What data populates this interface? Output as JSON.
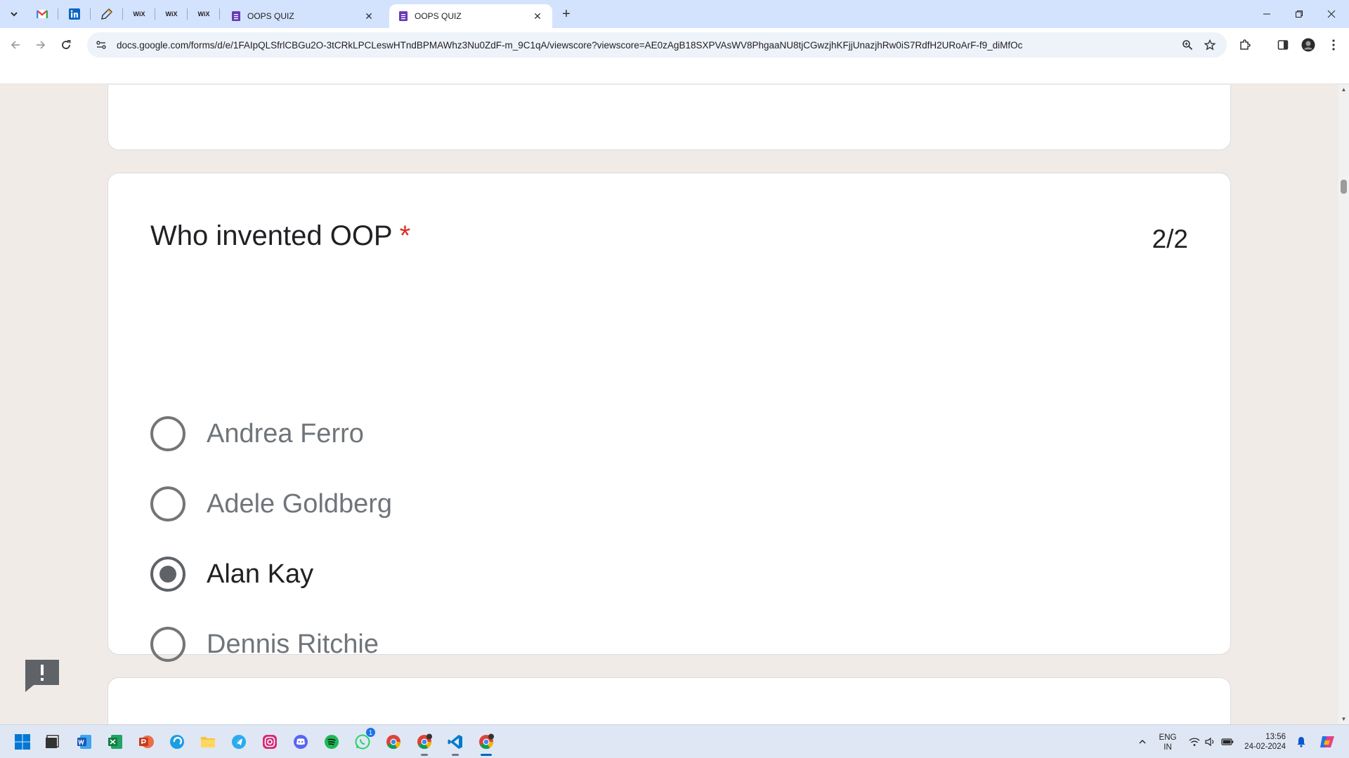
{
  "browser": {
    "tabs": [
      {
        "title": "OOPS QUIZ",
        "active": false
      },
      {
        "title": "OOPS QUIZ",
        "active": true
      }
    ],
    "pinned_tabs": [
      "gmail-icon",
      "linkedin-icon",
      "pen-icon",
      "wix-icon",
      "wix-icon",
      "wix-icon"
    ],
    "pinned_wix_label": "WiX",
    "url": "docs.google.com/forms/d/e/1FAIpQLSfrlCBGu2O-3tCRkLPCLeswHTndBPMAWhz3Nu0ZdF-m_9C1qA/viewscore?viewscore=AE0zAgB18SXPVAsWV8PhgaaNU8tjCGwzjhKFjjUnazjhRw0iS7RdfH2URoArF-f9_diMfOc"
  },
  "question": {
    "title": "Who invented OOP",
    "required_mark": "*",
    "score": "2/2",
    "options": [
      {
        "label": "Andrea Ferro",
        "selected": false
      },
      {
        "label": "Adele Goldberg",
        "selected": false
      },
      {
        "label": "Alan Kay",
        "selected": true
      },
      {
        "label": "Dennis Ritchie",
        "selected": false
      }
    ]
  },
  "taskbar": {
    "apps": [
      "windows-start-icon",
      "file-manager-icon",
      "word-icon",
      "excel-icon",
      "powerpoint-icon",
      "edge-icon",
      "file-explorer-icon",
      "telegram-icon",
      "instagram-icon",
      "discord-icon",
      "spotify-icon",
      "whatsapp-icon",
      "chrome-icon",
      "chrome-profile-icon",
      "vscode-icon",
      "chrome-active-icon"
    ],
    "whatsapp_badge": "1",
    "language_top": "ENG",
    "language_bottom": "IN",
    "time": "13:56",
    "date": "24-02-2024"
  },
  "colors": {
    "page_background": "#f0ebe7",
    "required_red": "#d93025",
    "tab_strip": "#d3e3fd",
    "forms_purple": "#673ab7"
  }
}
